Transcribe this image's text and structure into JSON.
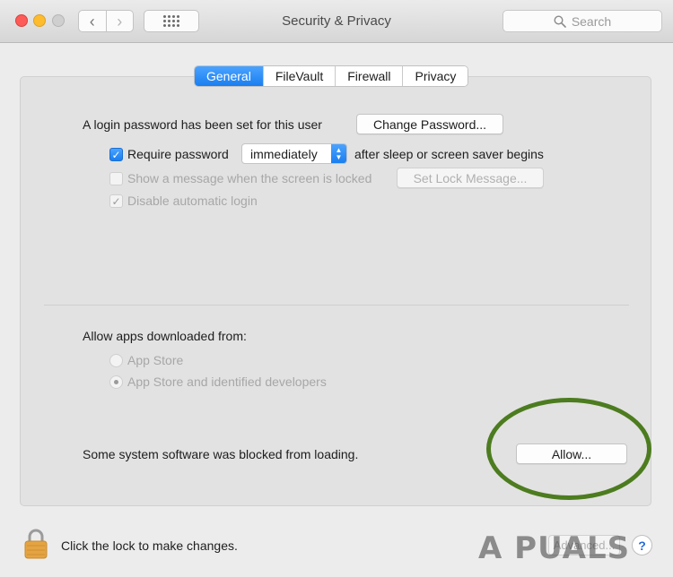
{
  "window": {
    "title": "Security & Privacy",
    "search_placeholder": "Search"
  },
  "nav": {
    "back_glyph": "‹",
    "forward_glyph": "›"
  },
  "tabs": [
    {
      "label": "General",
      "active": true
    },
    {
      "label": "FileVault",
      "active": false
    },
    {
      "label": "Firewall",
      "active": false
    },
    {
      "label": "Privacy",
      "active": false
    }
  ],
  "general": {
    "login_password_text": "A login password has been set for this user",
    "change_password_button": "Change Password...",
    "require_password": {
      "label": "Require password",
      "checked": true,
      "select_value": "immediately",
      "suffix": "after sleep or screen saver begins"
    },
    "show_message": {
      "label": "Show a message when the screen is locked",
      "checked": false,
      "button": "Set Lock Message..."
    },
    "disable_auto_login": {
      "label": "Disable automatic login",
      "checked": true
    },
    "allow_apps": {
      "heading": "Allow apps downloaded from:",
      "options": [
        {
          "label": "App Store",
          "selected": false
        },
        {
          "label": "App Store and identified developers",
          "selected": true
        }
      ]
    },
    "blocked": {
      "text": "Some system software was blocked from loading.",
      "button": "Allow..."
    }
  },
  "footer": {
    "lock_text": "Click the lock to make changes.",
    "advanced_button": "Advanced...",
    "help_glyph": "?",
    "watermark": "A  PUALS"
  },
  "colors": {
    "accent": "#1a7ef0",
    "highlight_ellipse": "#4c7c1f"
  }
}
